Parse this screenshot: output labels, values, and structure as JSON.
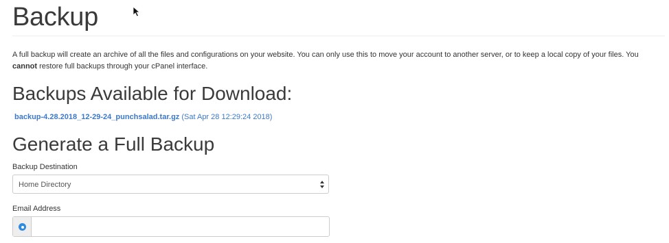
{
  "header": {
    "title": "Backup"
  },
  "intro": {
    "part1": "A full backup will create an archive of all the files and configurations on your website. You can only use this to move your account to another server, or to keep a local copy of your files. You ",
    "emphasis": "cannot",
    "part2": " restore full backups through your cPanel interface."
  },
  "downloads": {
    "heading": "Backups Available for Download:",
    "items": [
      {
        "filename": "backup-4.28.2018_12-29-24_punchsalad.tar.gz",
        "date": "(Sat Apr 28 12:29:24 2018)"
      }
    ]
  },
  "generate": {
    "heading": "Generate a Full Backup",
    "destination_label": "Backup Destination",
    "destination_value": "Home Directory",
    "email_label": "Email Address",
    "email_value": ""
  },
  "colors": {
    "link": "#3c78c8",
    "accent": "#2f8ae0"
  },
  "icons": {
    "cursor": "mouse-pointer-icon",
    "select_arrows": "chevron-up-down-icon",
    "email_option": "radio-button-icon"
  }
}
